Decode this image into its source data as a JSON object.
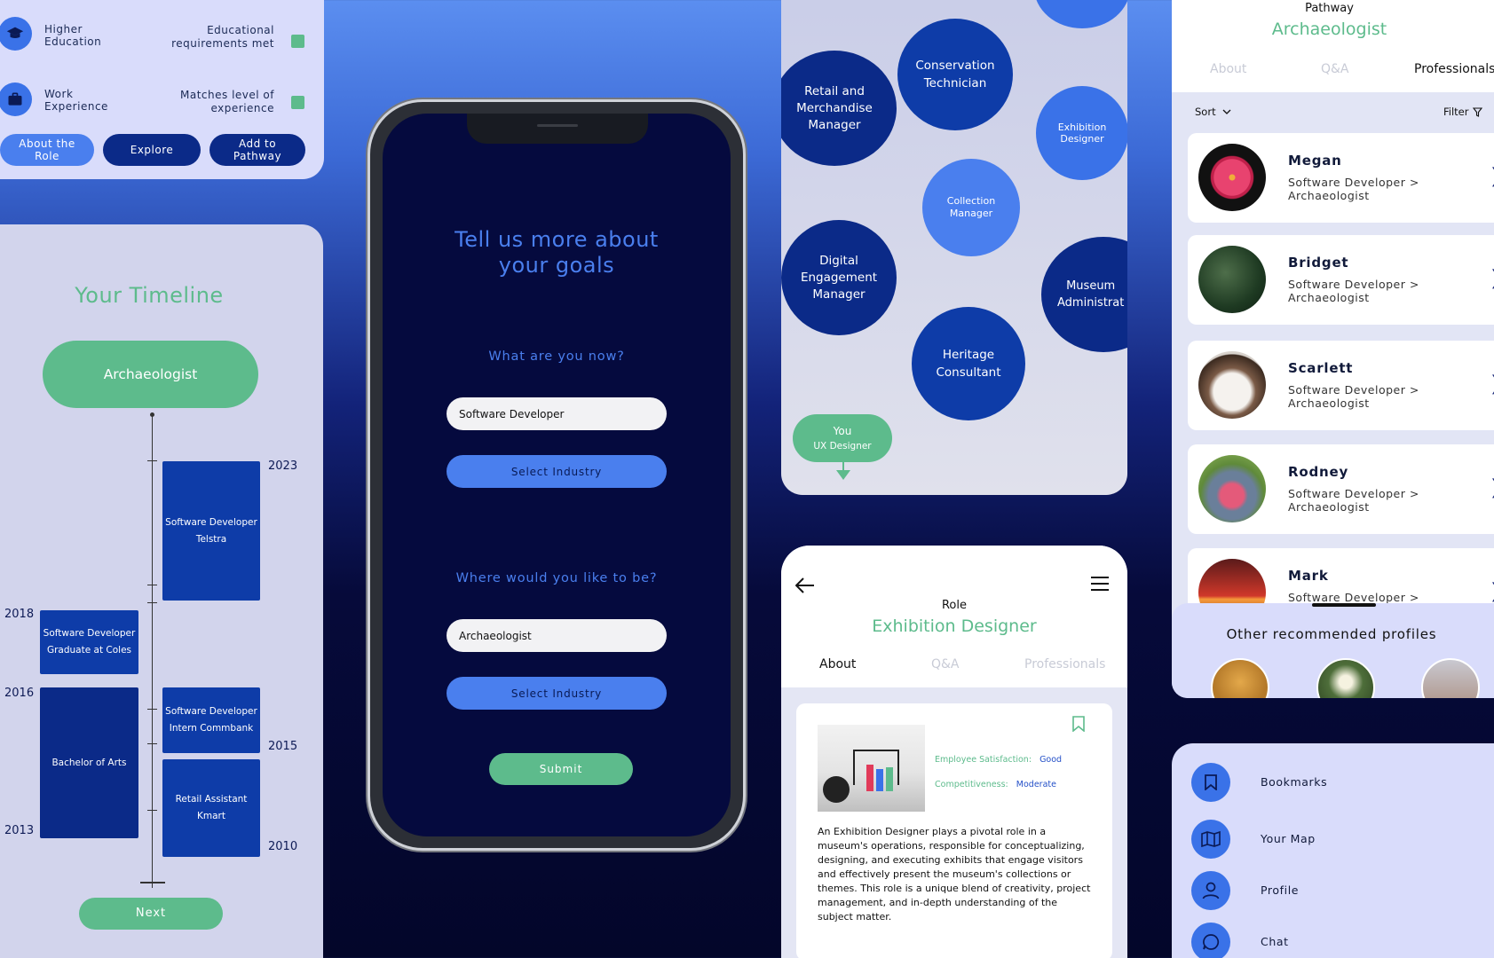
{
  "requirements": {
    "rows": [
      {
        "label": "Higher Education",
        "status": "Educational requirements met",
        "icon": "graduation-cap-icon"
      },
      {
        "label": "Work Experience",
        "status": "Matches level of experience",
        "icon": "briefcase-icon"
      }
    ],
    "buttons": {
      "about": "About the Role",
      "explore": "Explore",
      "add": "Add to Pathway"
    }
  },
  "timeline": {
    "title": "Your Timeline",
    "goal": "Archaeologist",
    "entries": [
      {
        "line1": "Software Developer",
        "line2": "Telstra",
        "year": "2023"
      },
      {
        "line1": "Software Developer",
        "line2": "Graduate at Coles",
        "year": "2018"
      },
      {
        "line1": "Bachelor of Arts",
        "line2": "",
        "year": "2016",
        "year_end": "2013"
      },
      {
        "line1": "Software Developer",
        "line2": "Intern Commbank",
        "year": "2015"
      },
      {
        "line1": "Retail Assistant",
        "line2": "Kmart",
        "year": "2010"
      }
    ],
    "next": "Next"
  },
  "goals": {
    "title": "Tell us more about your goals",
    "q1": "What are you now?",
    "current": "Software Developer",
    "industry1": "Select Industry",
    "q2": "Where would you like to be?",
    "target": "Archaeologist",
    "industry2": "Select Industry",
    "submit": "Submit"
  },
  "map": {
    "bubbles": [
      {
        "label": "Retail and Merchandise Manager"
      },
      {
        "label": "Conservation Technician"
      },
      {
        "label": "Exhibition Designer"
      },
      {
        "label": "Collection Manager"
      },
      {
        "label": "Digital Engagement Manager"
      },
      {
        "label": "Museum Administrat"
      },
      {
        "label": "Heritage Consultant"
      }
    ],
    "you": {
      "title": "You",
      "role": "UX Designer"
    }
  },
  "role": {
    "kicker": "Role",
    "title": "Exhibition Designer",
    "tabs": [
      "About",
      "Q&A",
      "Professionals"
    ],
    "satisfaction_label": "Employee Satisfaction:",
    "satisfaction_value": "Good",
    "competitiveness_label": "Competitiveness:",
    "competitiveness_value": "Moderate",
    "description": "An Exhibition Designer plays a pivotal role in a museum's operations, responsible for conceptualizing, designing, and executing exhibits that engage visitors and effectively present the museum's collections or themes. This role is a unique blend of creativity, project management, and in-depth understanding of the subject matter."
  },
  "pathway": {
    "kicker": "Pathway",
    "title": "Archaeologist",
    "tabs": [
      "About",
      "Q&A",
      "Professionals"
    ],
    "sort": "Sort",
    "filter": "Filter",
    "profiles": [
      {
        "name": "Megan",
        "role": "Software Developer > Archaeologist"
      },
      {
        "name": "Bridget",
        "role": "Software Developer > Archaeologist"
      },
      {
        "name": "Scarlett",
        "role": "Software Developer > Archaeologist"
      },
      {
        "name": "Rodney",
        "role": "Software Developer > Archaeologist"
      },
      {
        "name": "Mark",
        "role": "Software Developer >"
      }
    ],
    "other": "Other recommended profiles"
  },
  "menu": {
    "items": [
      {
        "label": "Bookmarks",
        "icon": "bookmark-icon"
      },
      {
        "label": "Your Map",
        "icon": "map-icon"
      },
      {
        "label": "Profile",
        "icon": "user-icon"
      },
      {
        "label": "Chat",
        "icon": "chat-icon"
      }
    ]
  },
  "colors": {
    "accent": "#3a72e8",
    "navy": "#0b2a88",
    "green": "#5dbb8c",
    "dark": "#050a3e"
  }
}
